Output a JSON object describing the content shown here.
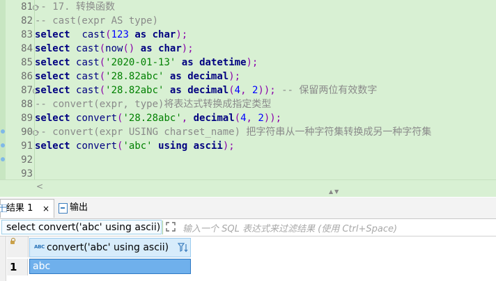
{
  "editor": {
    "lines": [
      {
        "n": "81",
        "fold": true,
        "segs": [
          [
            "cm",
            "-- 17. 转换函数"
          ]
        ]
      },
      {
        "n": "82",
        "segs": [
          [
            "cm",
            "-- cast(expr AS type)"
          ]
        ]
      },
      {
        "n": "83",
        "segs": [
          [
            "kw",
            "select"
          ],
          [
            "",
            "  "
          ],
          [
            "fn",
            "cast"
          ],
          [
            "op",
            "("
          ],
          [
            "num",
            "123"
          ],
          [
            "",
            " "
          ],
          [
            "kw",
            "as"
          ],
          [
            "",
            " "
          ],
          [
            "kw",
            "char"
          ],
          [
            "op",
            ");"
          ]
        ]
      },
      {
        "n": "84",
        "segs": [
          [
            "kw",
            "select"
          ],
          [
            "",
            " "
          ],
          [
            "fn",
            "cast"
          ],
          [
            "op",
            "("
          ],
          [
            "fn",
            "now"
          ],
          [
            "op",
            "()"
          ],
          [
            "",
            " "
          ],
          [
            "kw",
            "as"
          ],
          [
            "",
            " "
          ],
          [
            "kw",
            "char"
          ],
          [
            "op",
            ");"
          ]
        ]
      },
      {
        "n": "85",
        "segs": [
          [
            "kw",
            "select"
          ],
          [
            "",
            " "
          ],
          [
            "fn",
            "cast"
          ],
          [
            "op",
            "("
          ],
          [
            "str",
            "'2020-01-13'"
          ],
          [
            "",
            " "
          ],
          [
            "kw",
            "as"
          ],
          [
            "",
            " "
          ],
          [
            "kw",
            "datetime"
          ],
          [
            "op",
            ");"
          ]
        ]
      },
      {
        "n": "86",
        "segs": [
          [
            "kw",
            "select"
          ],
          [
            "",
            " "
          ],
          [
            "fn",
            "cast"
          ],
          [
            "op",
            "("
          ],
          [
            "str",
            "'28.82abc'"
          ],
          [
            "",
            " "
          ],
          [
            "kw",
            "as"
          ],
          [
            "",
            " "
          ],
          [
            "kw",
            "decimal"
          ],
          [
            "op",
            ");"
          ]
        ]
      },
      {
        "n": "87",
        "fold": true,
        "segs": [
          [
            "kw",
            "select"
          ],
          [
            "",
            " "
          ],
          [
            "fn",
            "cast"
          ],
          [
            "op",
            "("
          ],
          [
            "str",
            "'28.82abc'"
          ],
          [
            "",
            " "
          ],
          [
            "kw",
            "as"
          ],
          [
            "",
            " "
          ],
          [
            "kw",
            "decimal"
          ],
          [
            "op",
            "("
          ],
          [
            "num",
            "4"
          ],
          [
            "op",
            ", "
          ],
          [
            "num",
            "2"
          ],
          [
            "op",
            "));"
          ],
          [
            "cm",
            " -- 保留两位有效数字"
          ]
        ]
      },
      {
        "n": "88",
        "segs": [
          [
            "cm",
            "-- convert(expr, type)将表达式转换成指定类型"
          ]
        ]
      },
      {
        "n": "89",
        "segs": [
          [
            "kw",
            "select"
          ],
          [
            "",
            " "
          ],
          [
            "fn",
            "convert"
          ],
          [
            "op",
            "("
          ],
          [
            "str",
            "'28.28abc'"
          ],
          [
            "op",
            ", "
          ],
          [
            "kw",
            "decimal"
          ],
          [
            "op",
            "("
          ],
          [
            "num",
            "4"
          ],
          [
            "op",
            ", "
          ],
          [
            "num",
            "2"
          ],
          [
            "op",
            "));"
          ]
        ]
      },
      {
        "n": "90",
        "fold": true,
        "segs": [
          [
            "cm",
            "-- convert(expr USING charset_name) 把字符串从一种字符集转换成另一种字符集"
          ]
        ]
      },
      {
        "n": "91",
        "segs": [
          [
            "kw",
            "select"
          ],
          [
            "",
            " "
          ],
          [
            "fn",
            "convert"
          ],
          [
            "op",
            "("
          ],
          [
            "str",
            "'abc'"
          ],
          [
            "",
            " "
          ],
          [
            "kw",
            "using"
          ],
          [
            "",
            " "
          ],
          [
            "kw",
            "ascii"
          ],
          [
            "op",
            ");"
          ]
        ]
      },
      {
        "n": "92",
        "segs": []
      },
      {
        "n": "93",
        "segs": []
      }
    ]
  },
  "tabs": {
    "result_label": "结果 1",
    "close_glyph": "×",
    "output_label": "输出"
  },
  "filter": {
    "query": "select convert('abc' using ascii)",
    "placeholder": "输入一个 SQL 表达式来过滤结果 (使用 Ctrl+Space)"
  },
  "grid": {
    "column_header": "convert('abc' using ascii)",
    "column_type_icon": "ABC",
    "row_number": "1",
    "cell_value": "abc"
  },
  "colors": {
    "editor_bg": "#d8f0d3",
    "keyword": "#000080",
    "string": "#008000",
    "comment": "#8a8a8a",
    "selection": "#6fb0ec"
  }
}
